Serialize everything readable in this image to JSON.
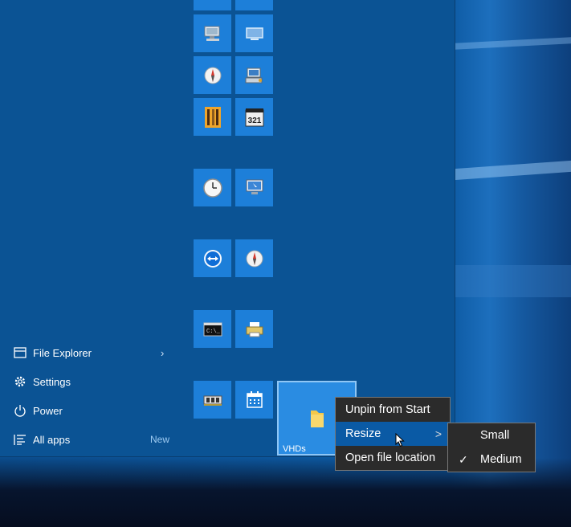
{
  "nav": {
    "file_explorer": "File Explorer",
    "settings": "Settings",
    "power": "Power",
    "all_apps": "All apps",
    "all_apps_badge": "New",
    "chevron": "›"
  },
  "tiles": {
    "vhds_label": "VHDs"
  },
  "context_menu": {
    "unpin": "Unpin from Start",
    "resize": "Resize",
    "open_location": "Open file location",
    "arrow": ">"
  },
  "resize_submenu": {
    "small": "Small",
    "medium": "Medium",
    "selected": "Medium",
    "check": "✓"
  },
  "colors": {
    "start_bg": "#0b5394",
    "tile": "#1d7fd9",
    "menu_bg": "#2b2b2b",
    "menu_hover": "#0a5aa5"
  },
  "icons": [
    "remote-desktop-icon",
    "monitor-icon",
    "compass-icon",
    "computer-tools-icon",
    "film-icon",
    "media-player-321-icon",
    "clock-icon",
    "display-settings-icon",
    "teamviewer-icon",
    "compass-icon",
    "cmd-icon",
    "printer-icon",
    "memory-chip-icon",
    "calendar-icon",
    "folder-icon"
  ]
}
